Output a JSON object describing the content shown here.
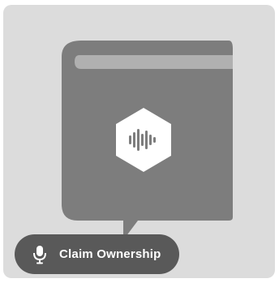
{
  "cover": {
    "placeholder_icon": "book-icon",
    "logo_icon": "soundwave-hexagon-icon"
  },
  "claim": {
    "icon": "microphone-icon",
    "label": "Claim Ownership"
  },
  "colors": {
    "card_background": "#dcdcdc",
    "book": "#7d7d7d",
    "book_top": "#b3b3b3",
    "button_background": "#595959",
    "button_text": "#ffffff"
  }
}
